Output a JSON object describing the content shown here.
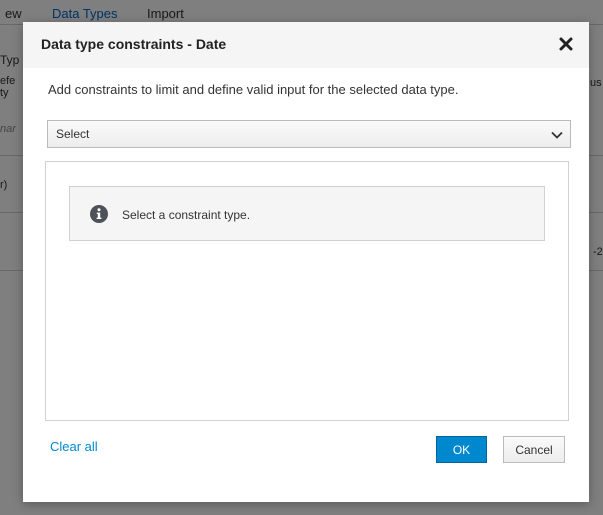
{
  "background": {
    "tabs": [
      {
        "label": "ew"
      },
      {
        "label": "Data Types"
      },
      {
        "label": "Import"
      }
    ],
    "fragments": {
      "f1": "Typ",
      "f2": "efe",
      "f3": "ty",
      "f4": "nar",
      "f5": "r)",
      "f6": "us",
      "f7": "-2"
    }
  },
  "modal": {
    "title": "Data type constraints - Date",
    "description": "Add constraints to limit and define valid input for the selected data type.",
    "select": {
      "value": "Select"
    },
    "info_message": "Select a constraint type.",
    "clear_all_label": "Clear all",
    "ok_label": "OK",
    "cancel_label": "Cancel",
    "icons": {
      "close": "close-icon",
      "chevron": "chevron-down-icon",
      "info": "info-icon"
    }
  },
  "colors": {
    "primary": "#0088ce",
    "link": "#0088ce",
    "header_bg": "#f5f5f5",
    "info_bg": "#f5f5f5"
  }
}
